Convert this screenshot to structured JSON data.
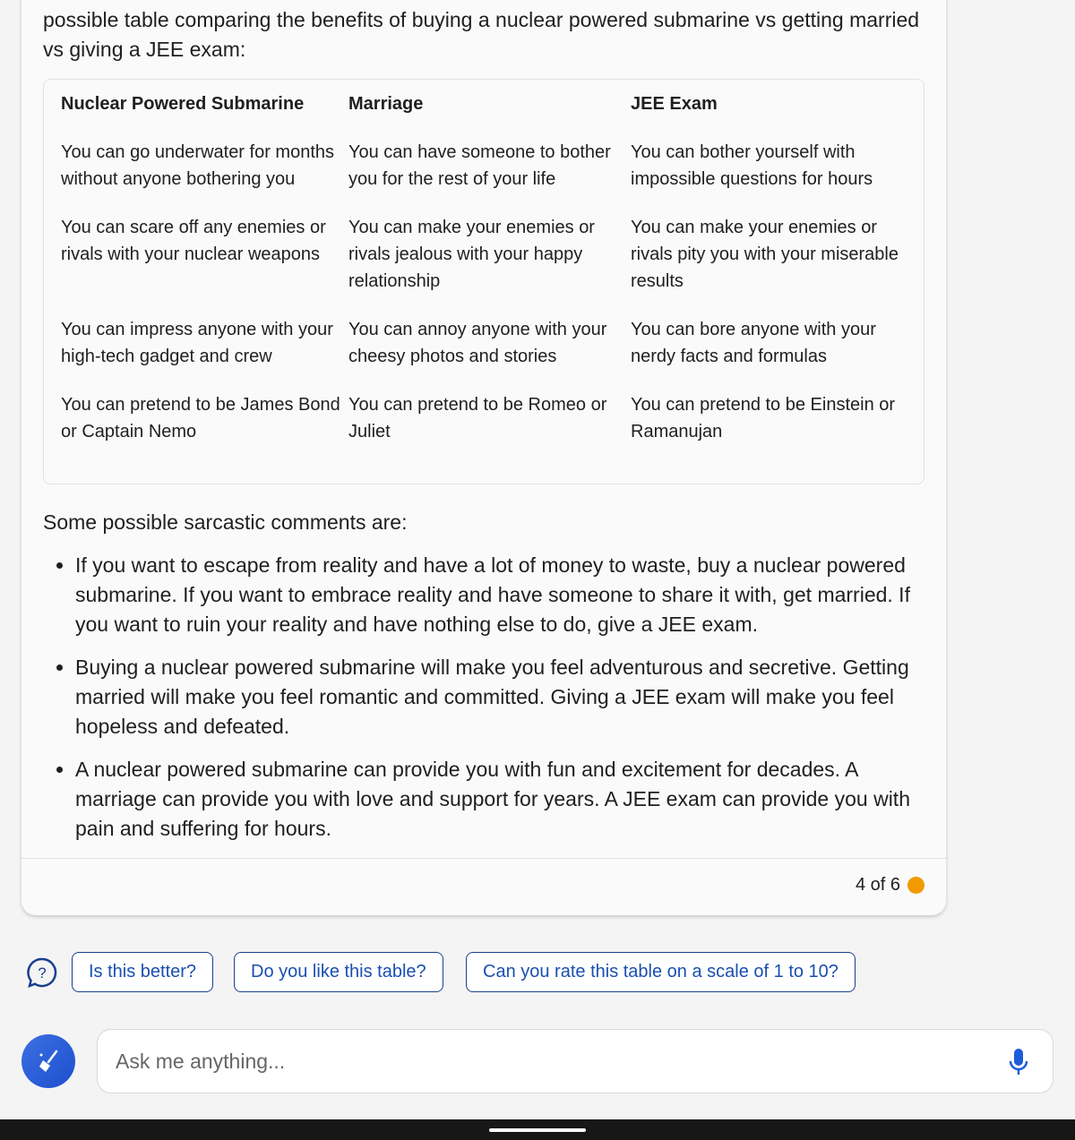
{
  "message": {
    "intro": "possible table comparing the benefits of buying a nuclear powered submarine vs getting married vs giving a JEE exam:",
    "table": {
      "headers": [
        "Nuclear Powered Submarine",
        "Marriage",
        "JEE Exam"
      ],
      "rows": [
        [
          "You can go underwater for months without anyone bothering you",
          "You can have someone to bother you for the rest of your life",
          "You can bother yourself with impossible questions for hours"
        ],
        [
          "You can scare off any enemies or rivals with your nuclear weapons",
          "You can make your enemies or rivals jealous with your happy relationship",
          "You can make your enemies or rivals pity you with your miserable results"
        ],
        [
          "You can impress anyone with your high-tech gadget and crew",
          "You can annoy anyone with your cheesy photos and stories",
          "You can bore anyone with your nerdy facts and formulas"
        ],
        [
          "You can pretend to be James Bond or Captain Nemo",
          "You can pretend to be Romeo or Juliet",
          "You can pretend to be Einstein or Ramanujan"
        ]
      ]
    },
    "subheading": "Some possible sarcastic comments are:",
    "bullets": [
      "If you want to escape from reality and have a lot of money to waste, buy a nuclear powered submarine. If you want to embrace reality and have someone to share it with, get married. If you want to ruin your reality and have nothing else to do, give a JEE exam.",
      "Buying a nuclear powered submarine will make you feel adventurous and secretive. Getting married will make you feel romantic and committed. Giving a JEE exam will make you feel hopeless and defeated.",
      "A nuclear powered submarine can provide you with fun and excitement for decades. A marriage can provide you with love and support for years. A JEE exam can provide you with pain and suffering for hours."
    ],
    "counter": "4 of 6",
    "counter_color": "#f29900"
  },
  "suggestions": [
    "Is this better?",
    "Do you like this table?",
    "Can you rate this table on a scale of 1 to 10?"
  ],
  "input": {
    "placeholder": "Ask me anything..."
  },
  "colors": {
    "accent": "#1e4fd0",
    "chip_text": "#1a4fb0"
  }
}
